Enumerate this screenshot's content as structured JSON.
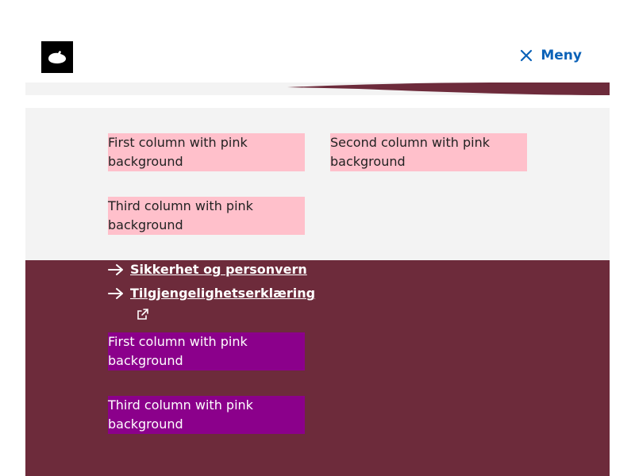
{
  "header": {
    "menu_label": "Meny",
    "logo": "brand-logo",
    "accent_color": "#6d2b3b",
    "menu_color": "#0b62b8"
  },
  "content": {
    "pink_boxes": [
      {
        "label": "First column with pink background"
      },
      {
        "label": "Second column with pink background"
      },
      {
        "label": "Third column with pink background"
      }
    ]
  },
  "footer": {
    "links": [
      {
        "label": "Sikkerhet og personvern",
        "icon": "arrow-right-icon"
      },
      {
        "label": "Tilgjengelighetserklæring",
        "icon": "arrow-right-icon",
        "external": true
      }
    ],
    "purple_boxes": [
      {
        "label": "First column with pink background"
      },
      {
        "label": "Third column with pink background"
      }
    ]
  },
  "colors": {
    "pink": "#ffc0cb",
    "purple": "#8b008b",
    "footer_bg": "#6d2b3b",
    "panel_bg": "#f3f3f3"
  }
}
